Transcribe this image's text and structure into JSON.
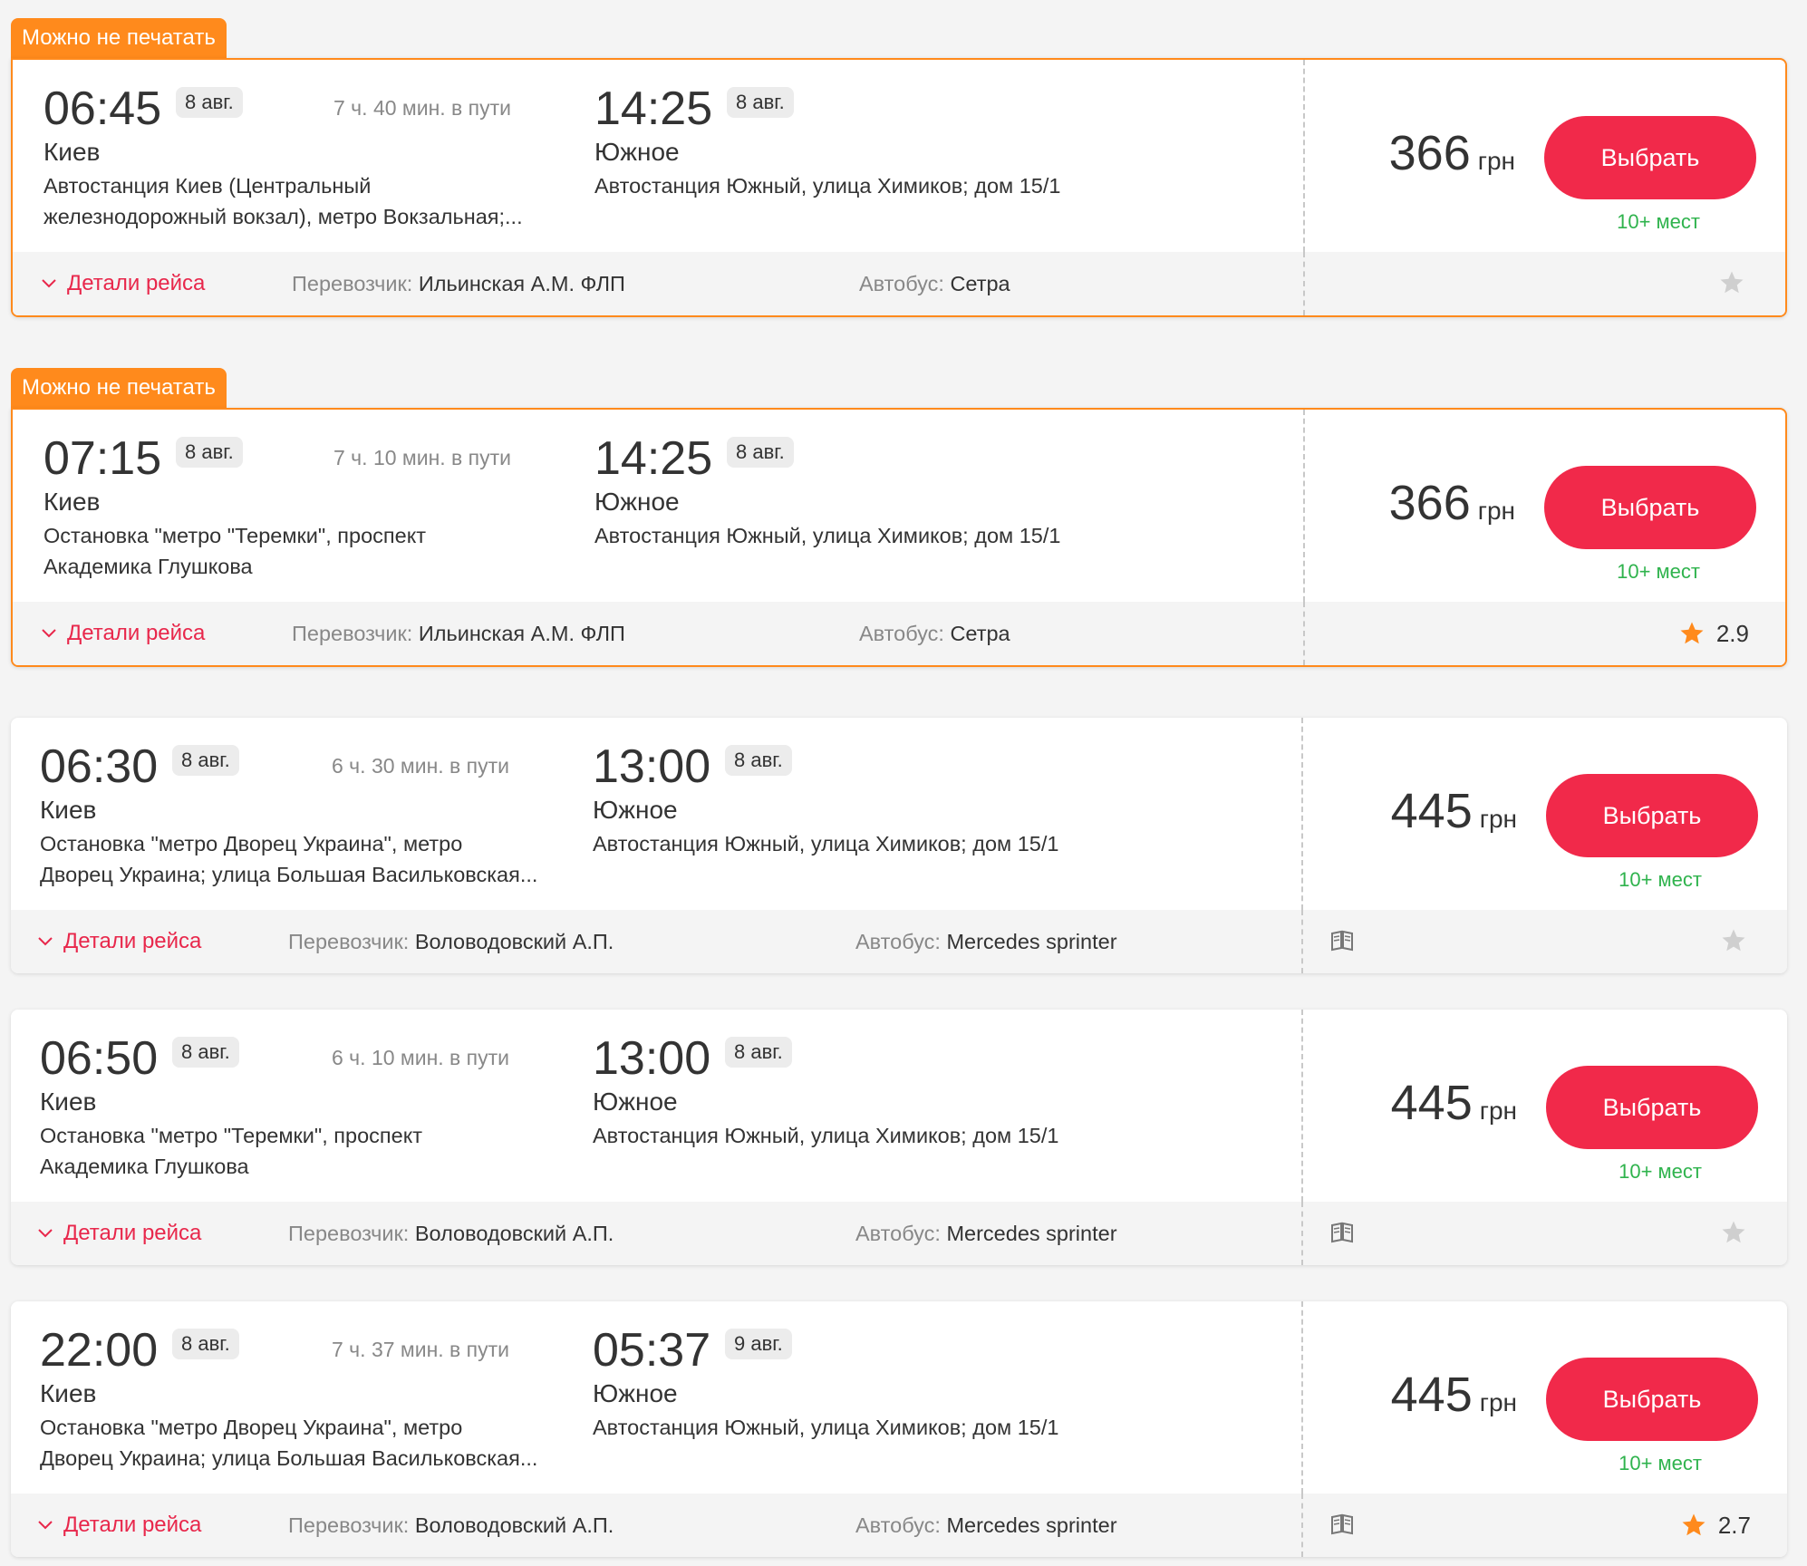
{
  "currency": "грн",
  "details_label": "Детали рейса",
  "carrier_label": "Перевозчик:",
  "bus_label": "Автобус:",
  "select_label": "Выбрать",
  "print_badge": "Можно не печатать",
  "colors": {
    "accent_orange": "#ff8a1c",
    "button_red": "#f1294a",
    "seats_green": "#2fb34d",
    "star_grey": "#cfcfcf",
    "star_orange": "#ff8a1c"
  },
  "trips": [
    {
      "badge": "Можно не печатать",
      "dep_time": "06:45",
      "dep_date": "8 авг.",
      "duration": "7 ч. 40 мин. в пути",
      "dep_city": "Киев",
      "dep_addr1": "Автостанция Киев (Центральный",
      "dep_addr2": "железнодорожный вокзал), метро Вокзальная;...",
      "arr_time": "14:25",
      "arr_date": "8 авг.",
      "arr_city": "Южное",
      "arr_addr": "Автостанция Южный, улица Химиков; дом 15/1",
      "price": "366",
      "seats": "10+ мест",
      "carrier": "Ильинская А.М. ФЛП",
      "bus": "Сетра",
      "rating": "",
      "book_icon": false
    },
    {
      "badge": "Можно не печатать",
      "dep_time": "07:15",
      "dep_date": "8 авг.",
      "duration": "7 ч. 10 мин. в пути",
      "dep_city": "Киев",
      "dep_addr1": "Остановка \"метро \"Теремки\", проспект",
      "dep_addr2": "Академика Глушкова",
      "arr_time": "14:25",
      "arr_date": "8 авг.",
      "arr_city": "Южное",
      "arr_addr": "Автостанция Южный, улица Химиков; дом 15/1",
      "price": "366",
      "seats": "10+ мест",
      "carrier": "Ильинская А.М. ФЛП",
      "bus": "Сетра",
      "rating": "2.9",
      "book_icon": false
    },
    {
      "badge": "",
      "dep_time": "06:30",
      "dep_date": "8 авг.",
      "duration": "6 ч. 30 мин. в пути",
      "dep_city": "Киев",
      "dep_addr1": "Остановка \"метро Дворец Украина\", метро",
      "dep_addr2": "Дворец Украина; улица Большая Васильковская...",
      "arr_time": "13:00",
      "arr_date": "8 авг.",
      "arr_city": "Южное",
      "arr_addr": "Автостанция Южный, улица Химиков; дом 15/1",
      "price": "445",
      "seats": "10+ мест",
      "carrier": "Воловодовский А.П.",
      "bus": "Mercedes sprinter",
      "rating": "",
      "book_icon": true
    },
    {
      "badge": "",
      "dep_time": "06:50",
      "dep_date": "8 авг.",
      "duration": "6 ч. 10 мин. в пути",
      "dep_city": "Киев",
      "dep_addr1": "Остановка \"метро \"Теремки\", проспект",
      "dep_addr2": "Академика Глушкова",
      "arr_time": "13:00",
      "arr_date": "8 авг.",
      "arr_city": "Южное",
      "arr_addr": "Автостанция Южный, улица Химиков; дом 15/1",
      "price": "445",
      "seats": "10+ мест",
      "carrier": "Воловодовский А.П.",
      "bus": "Mercedes sprinter",
      "rating": "",
      "book_icon": true
    },
    {
      "badge": "",
      "dep_time": "22:00",
      "dep_date": "8 авг.",
      "duration": "7 ч. 37 мин. в пути",
      "dep_city": "Киев",
      "dep_addr1": "Остановка \"метро Дворец Украина\", метро",
      "dep_addr2": "Дворец Украина; улица Большая Васильковская...",
      "arr_time": "05:37",
      "arr_date": "9 авг.",
      "arr_city": "Южное",
      "arr_addr": "Автостанция Южный, улица Химиков; дом 15/1",
      "price": "445",
      "seats": "10+ мест",
      "carrier": "Воловодовский А.П.",
      "bus": "Mercedes sprinter",
      "rating": "2.7",
      "book_icon": true
    }
  ]
}
